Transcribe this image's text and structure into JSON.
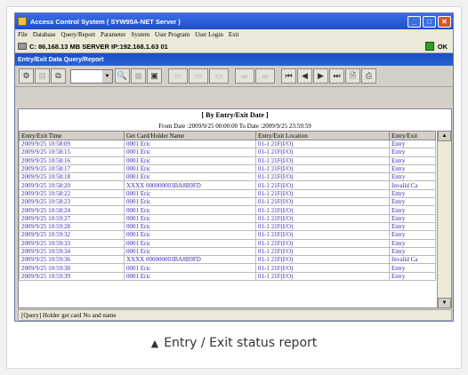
{
  "window": {
    "title": "Access Control System ( SYW95A-NET Server )",
    "controls": [
      "_",
      "□",
      "✕"
    ]
  },
  "menu": [
    "File",
    "Database",
    "Query/Report",
    "Parameter",
    "System",
    "User Program",
    "User Login",
    "Exit"
  ],
  "status_line": {
    "text": "C: 86,168.13 MB   SERVER IP:192.168.1.63  01",
    "ok_label": "OK"
  },
  "subwindow_title": "Entry/Exit Data Query/Report",
  "report": {
    "heading": "[ By Entry/Exit Date ]",
    "date_range": "From Date :2009/9/25 00:00:00   To Date :2009/9/25 23:59:59",
    "columns": [
      "Entry/Exit Time",
      "Get Card/Holder Name",
      "Entry/Exit Location",
      "Entry/Exit"
    ],
    "rows": [
      [
        "2009/9/25 10:58:09",
        "0001 Eric",
        "01-1 21F(I/O)",
        "Entry"
      ],
      [
        "2009/9/25 10:58:15",
        "0001 Eric",
        "01-1 21F(I/O)",
        "Entry"
      ],
      [
        "2009/9/25 10:58:16",
        "0001 Eric",
        "01-1 21F(I/O)",
        "Entry"
      ],
      [
        "2009/9/25 10:58:17",
        "0001 Eric",
        "01-1 21F(I/O)",
        "Entry"
      ],
      [
        "2009/9/25 10:58:18",
        "0001 Eric",
        "01-1 21F(I/O)",
        "Entry"
      ],
      [
        "2009/9/25 10:58:20",
        "XXXX 000000003BA8B9FD",
        "01-1 21F(I/O)",
        "Invalid Ca"
      ],
      [
        "2009/9/25 10:58:22",
        "0001 Eric",
        "01-1 21F(I/O)",
        "Entry"
      ],
      [
        "2009/9/25 10:58:23",
        "0001 Eric",
        "01-1 21F(I/O)",
        "Entry"
      ],
      [
        "2009/9/25 10:58:24",
        "0001 Eric",
        "01-1 21F(I/O)",
        "Entry"
      ],
      [
        "2009/9/25 10:59:27",
        "0001 Eric",
        "01-1 21F(I/O)",
        "Entry"
      ],
      [
        "2009/9/25 10:59:28",
        "0001 Eric",
        "01-1 21F(I/O)",
        "Entry"
      ],
      [
        "2009/9/25 10:59:32",
        "0001 Eric",
        "01-1 21F(I/O)",
        "Entry"
      ],
      [
        "2009/9/25 10:59:33",
        "0001 Eric",
        "01-1 21F(I/O)",
        "Entry"
      ],
      [
        "2009/9/25 10:59:34",
        "0001 Eric",
        "01-1 21F(I/O)",
        "Entry"
      ],
      [
        "2009/9/25 10:59:36",
        "XXXX 000000003BA8B9FD",
        "01-1 21F(I/O)",
        "Invalid Ca"
      ],
      [
        "2009/9/25 10:59:38",
        "0001 Eric",
        "01-1 21F(I/O)",
        "Entry"
      ],
      [
        "2009/9/25 10:59:39",
        "0001 Eric",
        "01-1 21F(I/O)",
        "Entry"
      ]
    ]
  },
  "window_status": "[Query]  Holder get card No and name",
  "caption": "Entry / Exit status report",
  "colors": {
    "title_bar": "#1d4fc6",
    "cell_text": "#3c2ab0",
    "close_button": "#d9532c"
  }
}
